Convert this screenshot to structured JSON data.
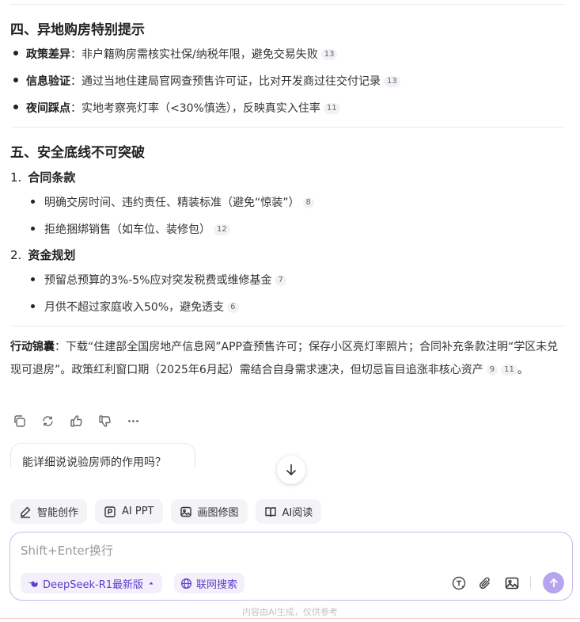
{
  "section4": {
    "title": "四、异地购房特别提示",
    "items": [
      {
        "label": "政策差异",
        "text": "：非户籍购房需核实社保/纳税年限，避免交易失败",
        "cite": "13"
      },
      {
        "label": "信息验证",
        "text": "：通过当地住建局官网查预售许可证，比对开发商过往交付记录",
        "cite": "13"
      },
      {
        "label": "夜间踩点",
        "text": "：实地考察亮灯率（<30%慎选），反映真实入住率",
        "cite": "11"
      }
    ]
  },
  "section5": {
    "title": "五、安全底线不可突破",
    "groups": [
      {
        "num": "1.",
        "title": "合同条款",
        "items": [
          {
            "text": "明确交房时间、违约责任、精装标准（避免“惊装”）",
            "cite": "8"
          },
          {
            "text": "拒绝捆绑销售（如车位、装修包）",
            "cite": "12"
          }
        ]
      },
      {
        "num": "2.",
        "title": "资金规划",
        "items": [
          {
            "text": "预留总预算的3%-5%应对突发税费或维修基金",
            "cite": "7"
          },
          {
            "text": "月供不超过家庭收入50%，避免透支",
            "cite": "6"
          }
        ]
      }
    ]
  },
  "action": {
    "label": "行动锦囊",
    "text": "：下载“住建部全国房地产信息网”APP查预售许可；保存小区亮灯率照片；合同补充条款注明“学区未兑现可退房”。政策红利窗口期（2025年6月起）需结合自身需求速决，但切忌盲目追涨非核心资产",
    "cites": [
      "9",
      "11"
    ],
    "end": "。"
  },
  "message_actions": [
    "copy-icon",
    "regenerate-icon",
    "thumbs-up-icon",
    "thumbs-down-icon",
    "more-icon"
  ],
  "suggestion": "能详细说说验房师的作用吗？",
  "tools": [
    {
      "icon": "pen-icon",
      "label": "智能创作"
    },
    {
      "icon": "ppt-icon",
      "label": "AI PPT"
    },
    {
      "icon": "image-edit-icon",
      "label": "画图修图"
    },
    {
      "icon": "reader-icon",
      "label": "AI阅读"
    }
  ],
  "input": {
    "placeholder": "Shift+Enter换行",
    "value": ""
  },
  "model_chip": "DeepSeek-R1最新版",
  "search_chip": "联网搜索",
  "footer": "内容由AI生成，仅供参考",
  "colors": {
    "accent": "#5a3fc8",
    "send": "#b6a5ec",
    "border": "#c9b8ee"
  }
}
